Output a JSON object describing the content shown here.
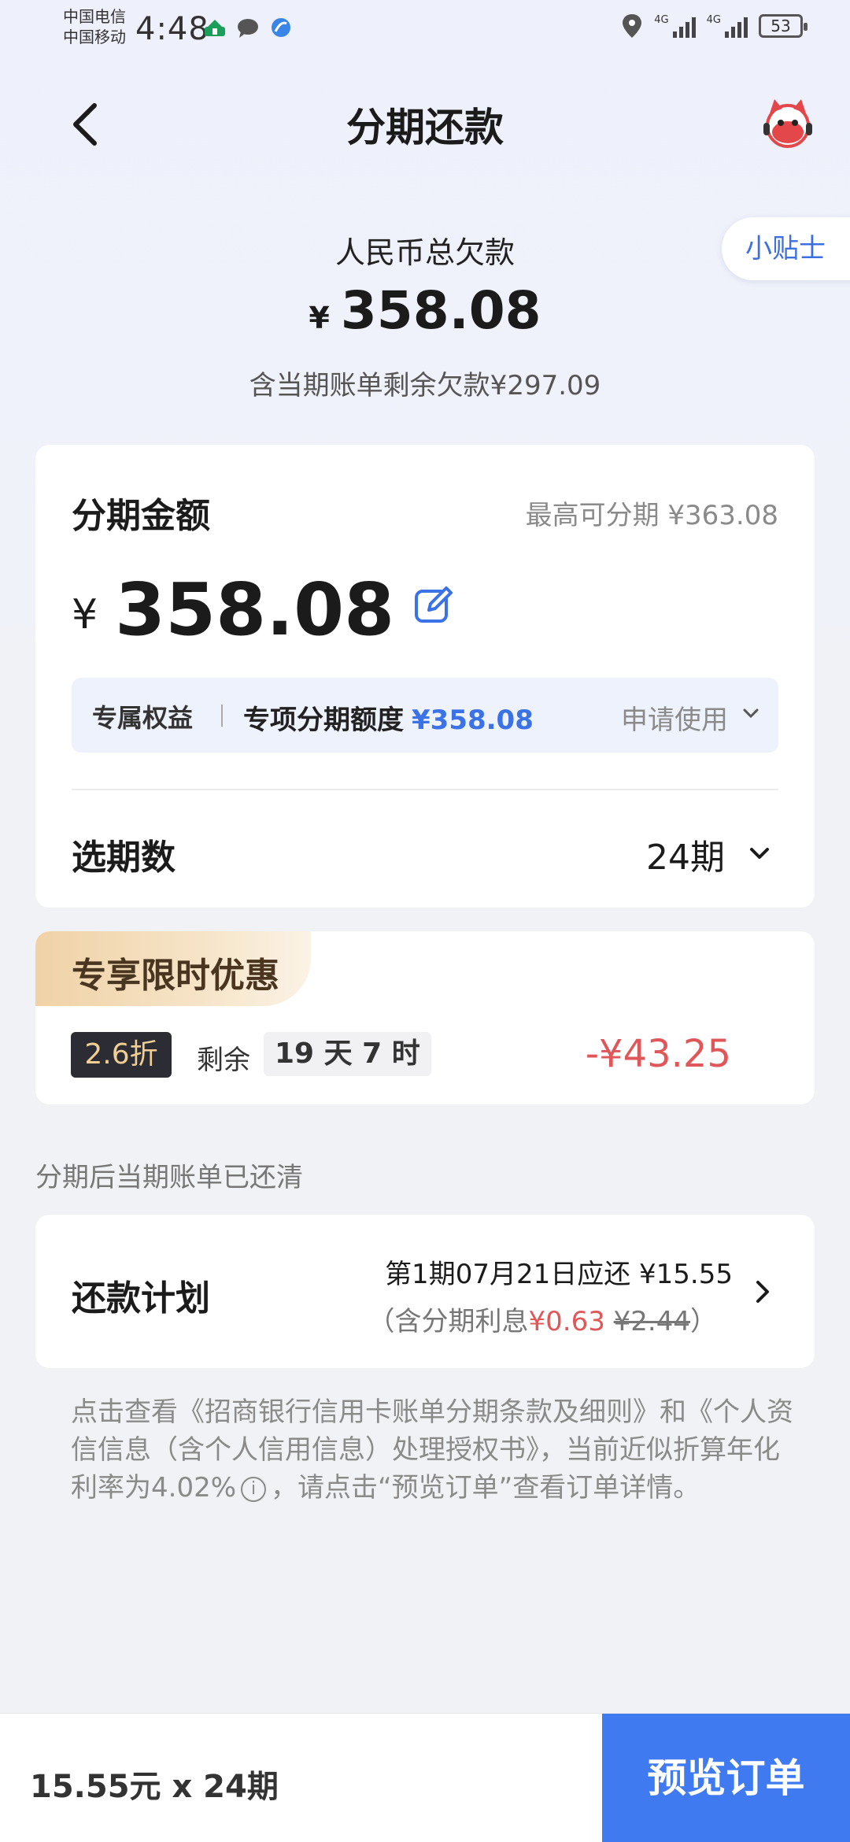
{
  "status_bar": {
    "carrier1": "中国电信",
    "carrier2": "中国移动",
    "time": "4:48",
    "battery": "53",
    "network1": "4G",
    "network2": "4G"
  },
  "nav": {
    "title": "分期还款",
    "tips_label": "小贴士"
  },
  "debt": {
    "label": "人民币总欠款",
    "currency": "¥",
    "amount": "358.08",
    "sub": "含当期账单剩余欠款¥297.09"
  },
  "installment": {
    "label": "分期金额",
    "max": "最高可分期 ¥363.08",
    "currency": "¥",
    "amount": "358.08",
    "benefit_tag": "专属权益",
    "benefit_text": "专项分期额度",
    "benefit_amount": "¥358.08",
    "benefit_action": "申请使用",
    "period_label": "选期数",
    "period_value": "24期"
  },
  "promo": {
    "title": "专享限时优惠",
    "discount": "2.6折",
    "remain_label": "剩余",
    "countdown": "19 天 7 时",
    "saving": "-¥43.25"
  },
  "cleared_note": "分期后当期账单已还清",
  "plan": {
    "label": "还款计划",
    "line1": "第1期07月21日应还 ¥15.55",
    "line2_prefix": "（含分期利息",
    "interest": "¥0.63",
    "original_interest": "¥2.44",
    "line2_suffix": "）"
  },
  "terms": {
    "part1": "点击查看",
    "link1": "《招商银行信用卡账单分期条款及细则》",
    "part2": "和",
    "link2": "《个人资信信息（含个人信用信息）处理授权书》",
    "part3": "，当前近似折算年化利率为4.02%",
    "part4": "，请点击“预览订单”查看订单详情。"
  },
  "footer": {
    "summary": "15.55元 x 24期",
    "preview_button": "预览订单"
  },
  "colors": {
    "accent": "#3f7af0",
    "link_blue": "#3b72e6",
    "red": "#e0575a",
    "gold": "#f1cf94"
  }
}
